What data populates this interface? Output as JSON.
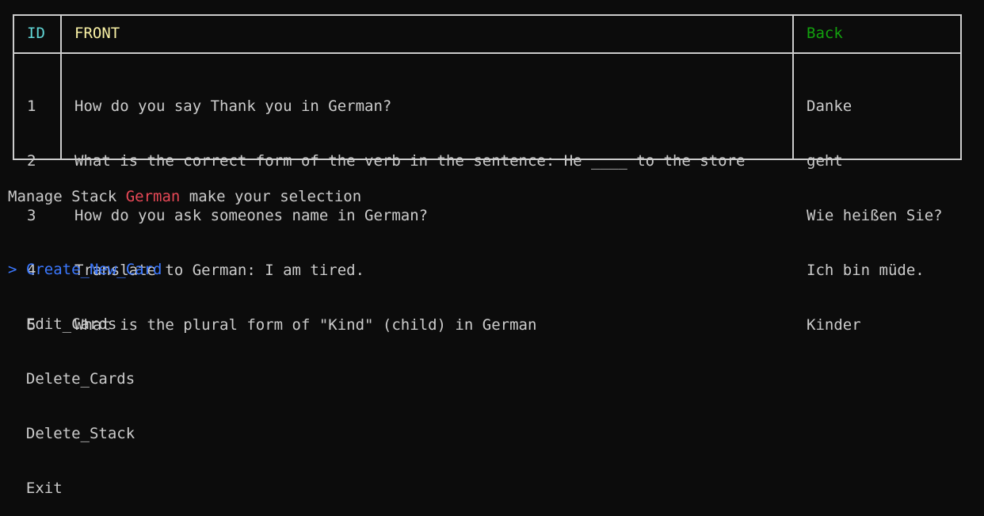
{
  "table": {
    "headers": {
      "id": "ID",
      "front": "FRONT",
      "back": "Back"
    },
    "rows": [
      {
        "id": "1",
        "front": "How do you say Thank you in German?",
        "back": "Danke"
      },
      {
        "id": "2",
        "front": "What is the correct form of the verb in the sentence: He ____ to the store",
        "back": "geht"
      },
      {
        "id": "3",
        "front": "How do you ask someones name in German?",
        "back": "Wie heißen Sie?"
      },
      {
        "id": "4",
        "front": "Translate to German: I am tired.",
        "back": "Ich bin müde."
      },
      {
        "id": "5",
        "front": "What is the plural form of \"Kind\" (child) in German",
        "back": "Kinder"
      }
    ]
  },
  "menu": {
    "title_prefix": "Manage Stack ",
    "stack_name": "German",
    "title_suffix": " make your selection",
    "cursor": ">",
    "items": [
      "Create_New_Card",
      "Edit_Cards",
      "Delete_Cards",
      "Delete_Stack",
      "Exit"
    ],
    "selected_index": 0
  },
  "colors": {
    "background": "#0c0c0c",
    "foreground": "#cccccc",
    "header_id": "#61d6d6",
    "header_front": "#f9f1a5",
    "header_back": "#13a10e",
    "stack_name": "#e74856",
    "selected_item": "#3b78ff"
  }
}
